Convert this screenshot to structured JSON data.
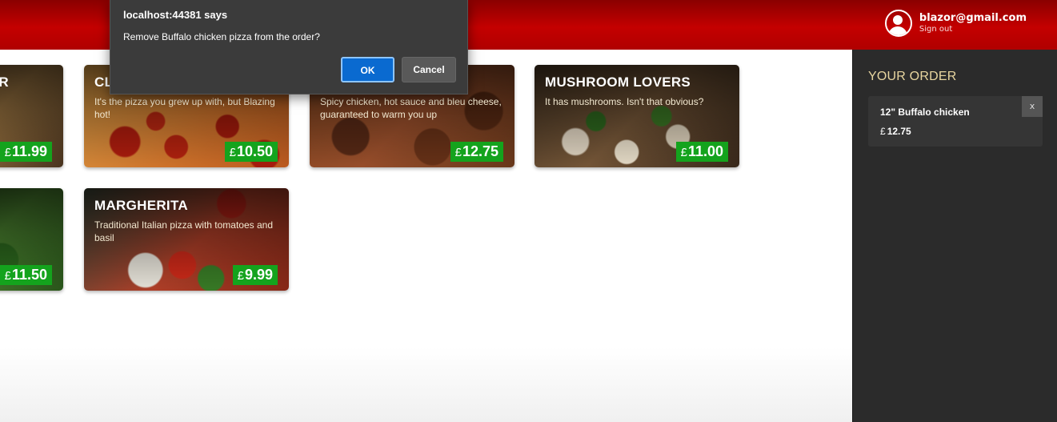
{
  "header": {
    "user_email": "blazor@gmail.com",
    "sign_out_label": "Sign out"
  },
  "pizzas": [
    {
      "title": "R",
      "description": "",
      "currency": "£",
      "price": "11.99"
    },
    {
      "title": "CL",
      "description": "It's the pizza you grew up with, but Blazing hot!",
      "currency": "£",
      "price": "10.50"
    },
    {
      "title": "",
      "description": "Spicy chicken, hot sauce and bleu cheese, guaranteed to warm you up",
      "currency": "£",
      "price": "12.75"
    },
    {
      "title": "MUSHROOM LOVERS",
      "description": "It has mushrooms. Isn't that obvious?",
      "currency": "£",
      "price": "11.00"
    },
    {
      "title": "",
      "description": "",
      "currency": "£",
      "price": "11.50"
    },
    {
      "title": "MARGHERITA",
      "description": "Traditional Italian pizza with tomatoes and basil",
      "currency": "£",
      "price": "9.99"
    }
  ],
  "order": {
    "heading": "YOUR ORDER",
    "items": [
      {
        "name": "12\" Buffalo chicken",
        "currency": "£",
        "price": "12.75",
        "remove_label": "x"
      }
    ]
  },
  "dialog": {
    "title": "localhost:44381 says",
    "message": "Remove Buffalo chicken pizza from the order?",
    "ok_label": "OK",
    "cancel_label": "Cancel"
  },
  "colors": {
    "header_red": "#c40000",
    "price_green": "#14a31d",
    "sidebar_dark": "#2b2b2b",
    "order_heading": "#e8d6a0",
    "dialog_ok_blue": "#0a6ad0"
  },
  "icons": {
    "user": "user-circle-icon"
  }
}
